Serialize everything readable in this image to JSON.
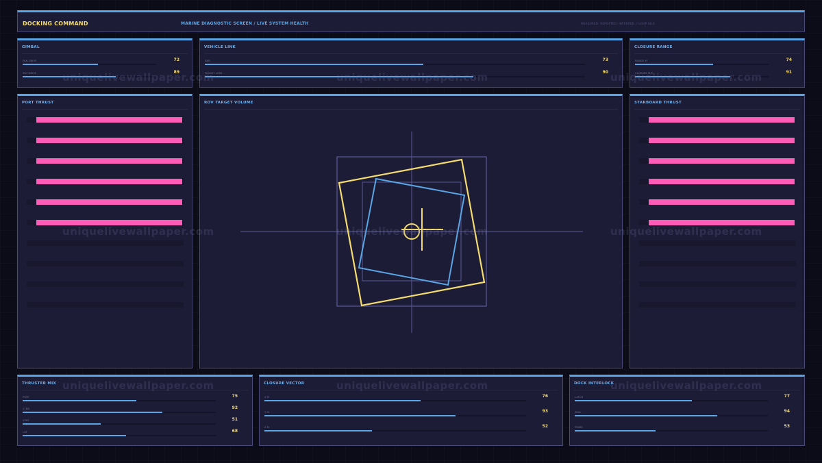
{
  "header": {
    "title": "DOCKING COMMAND",
    "subtitle": "MARINE DIAGNOSTIC SCREEN / LIVE SYSTEM HEALTH",
    "meta": "MEASURED. REPORTED. INFERRED. / LOOP 88.6"
  },
  "gimbal": {
    "title": "GIMBAL",
    "metrics": [
      {
        "label": "PAN DRIVE",
        "value": "72",
        "fraction": 0.72
      },
      {
        "label": "TILT DRIVE",
        "value": "89",
        "fraction": 0.89
      }
    ]
  },
  "vehicle_link": {
    "title": "VEHICLE LINK",
    "metrics": [
      {
        "label": "SNR",
        "value": "73",
        "fraction": 0.73
      },
      {
        "label": "PACKET LOSS",
        "value": "90",
        "fraction": 0.9
      }
    ]
  },
  "closure_range": {
    "title": "CLOSURE RANGE",
    "metrics": [
      {
        "label": "RANGE M",
        "value": "74",
        "fraction": 0.74
      },
      {
        "label": "CLOSURE M/S",
        "value": "91",
        "fraction": 0.91
      }
    ]
  },
  "port_thrust": {
    "title": "PORT THRUST",
    "levels": [
      1,
      1,
      1,
      1,
      1,
      1,
      0,
      0,
      0,
      0
    ]
  },
  "starboard_thrust": {
    "title": "STARBOARD THRUST",
    "levels": [
      1,
      1,
      1,
      1,
      1,
      1,
      0,
      0,
      0,
      0
    ]
  },
  "rov_target": {
    "title": "ROV TARGET VOLUME"
  },
  "thruster_mix": {
    "title": "THRUSTER MIX",
    "metrics": [
      {
        "label": "PORT",
        "value": "75",
        "fraction": 0.75
      },
      {
        "label": "STBD",
        "value": "92",
        "fraction": 0.92
      },
      {
        "label": "VERT",
        "value": "51",
        "fraction": 0.51
      },
      {
        "label": "LAT",
        "value": "68",
        "fraction": 0.68
      }
    ]
  },
  "closure_vector": {
    "title": "CLOSURE VECTOR",
    "metrics": [
      {
        "label": "X M",
        "value": "76",
        "fraction": 0.76
      },
      {
        "label": "Y M",
        "value": "93",
        "fraction": 0.93
      },
      {
        "label": "Z M",
        "value": "52",
        "fraction": 0.52
      }
    ]
  },
  "dock_interlock": {
    "title": "DOCK INTERLOCK",
    "metrics": [
      {
        "label": "LATCH",
        "value": "77",
        "fraction": 0.77
      },
      {
        "label": "SEAL",
        "value": "94",
        "fraction": 0.94
      },
      {
        "label": "PRIME",
        "value": "53",
        "fraction": 0.53
      }
    ]
  },
  "watermark": "uniquelivewallpaper.com",
  "colors": {
    "accent": "#5aa6e6",
    "highlight": "#f5dc6e",
    "thrust": "#ff5cb8",
    "panel": "#1d1c36",
    "background": "#0c0c18"
  }
}
